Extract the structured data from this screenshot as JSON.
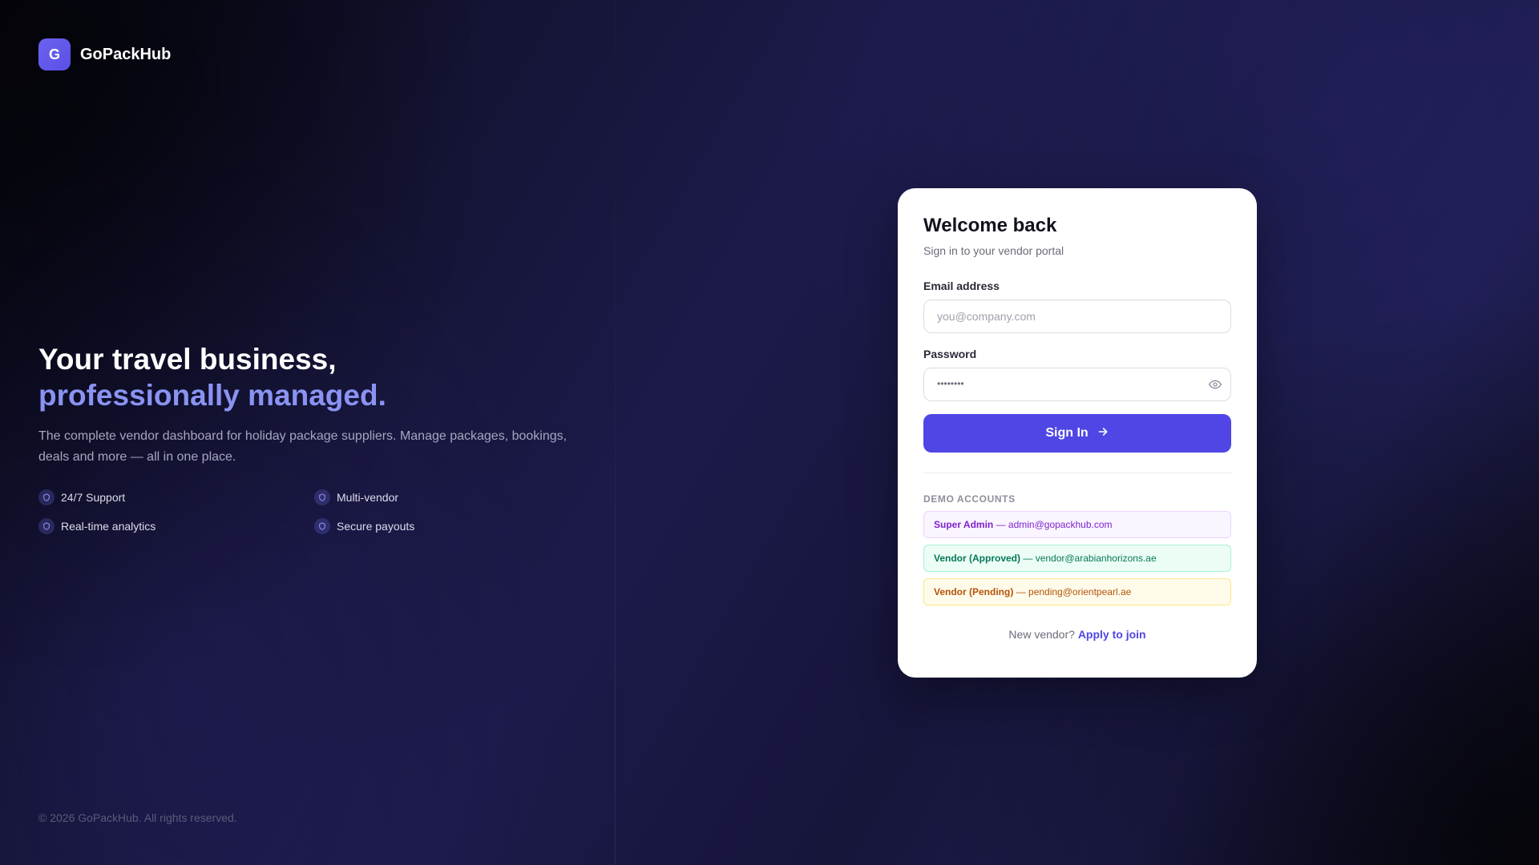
{
  "brand": {
    "logo_letter": "G",
    "name": "GoPackHub",
    "accent_color": "#5b4fe6"
  },
  "hero": {
    "title": "Your travel business,",
    "accent": "professionally managed.",
    "description": "The complete vendor dashboard for holiday package suppliers. Manage packages, bookings, deals and more — all in one place.",
    "features": [
      {
        "label": "24/7 Support",
        "icon": "shield-icon"
      },
      {
        "label": "Multi-vendor",
        "icon": "shield-icon"
      },
      {
        "label": "Real-time analytics",
        "icon": "shield-icon"
      },
      {
        "label": "Secure payouts",
        "icon": "shield-icon"
      }
    ]
  },
  "copyright": "© 2026 GoPackHub. All rights reserved.",
  "login": {
    "title": "Welcome back",
    "subtitle": "Sign in to your vendor portal",
    "email_label": "Email address",
    "email_placeholder": "you@company.com",
    "email_value": "",
    "password_label": "Password",
    "password_mask": "••••••••",
    "password_toggle_icon": "eye-icon",
    "submit_label": "Sign In",
    "submit_icon": "arrow-right-icon",
    "submit_color": "#4f46e5"
  },
  "demo": {
    "heading": "Demo Accounts",
    "accounts": [
      {
        "role": "Super Admin",
        "separator": " — ",
        "email": "admin@gopackhub.com",
        "color": "#7e22ce"
      },
      {
        "role": "Vendor (Approved)",
        "separator": " — ",
        "email": "vendor@arabianhorizons.ae",
        "color": "#047857"
      },
      {
        "role": "Vendor (Pending)",
        "separator": " — ",
        "email": "pending@orientpearl.ae",
        "color": "#b45309"
      }
    ]
  },
  "signup": {
    "prompt": "New vendor? ",
    "link": "Apply to join"
  }
}
